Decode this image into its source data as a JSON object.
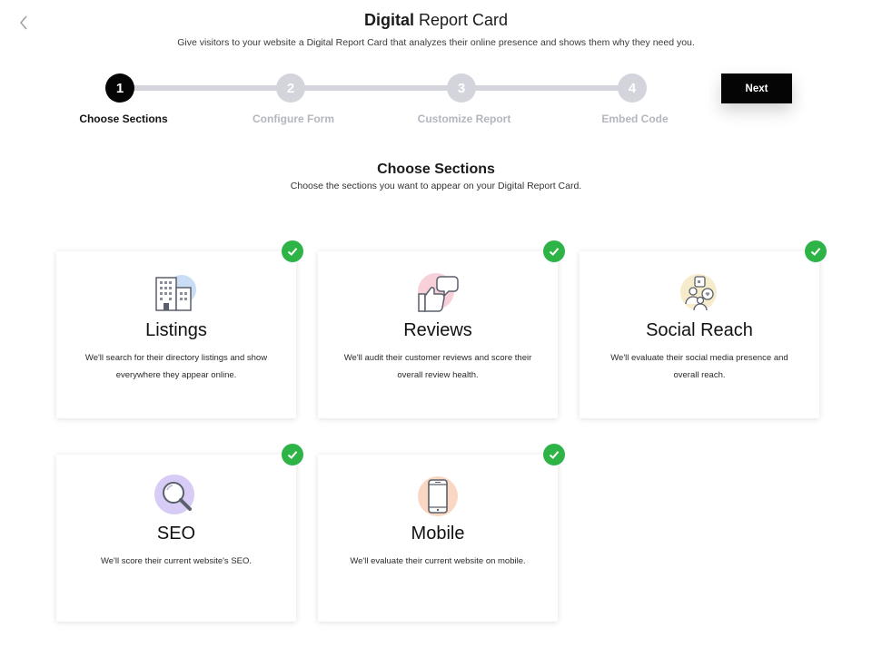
{
  "header": {
    "title_bold": "Digital",
    "title_rest": " Report Card",
    "subtitle": "Give visitors to your website a Digital Report Card that analyzes their online presence and shows them why they need you."
  },
  "stepper": {
    "steps": [
      {
        "number": "1",
        "label": "Choose Sections",
        "active": true
      },
      {
        "number": "2",
        "label": "Configure Form",
        "active": false
      },
      {
        "number": "3",
        "label": "Customize Report",
        "active": false
      },
      {
        "number": "4",
        "label": "Embed Code",
        "active": false
      }
    ],
    "next_label": "Next"
  },
  "section": {
    "title": "Choose Sections",
    "subtitle": "Choose the sections you want to appear on your Digital Report Card."
  },
  "cards": [
    {
      "title": "Listings",
      "description": "We'll search for their directory listings and show everywhere they appear online.",
      "icon": "building-icon",
      "selected": true
    },
    {
      "title": "Reviews",
      "description": "We'll audit their customer reviews and score their overall review health.",
      "icon": "thumbs-up-chat-icon",
      "selected": true
    },
    {
      "title": "Social Reach",
      "description": "We'll evaluate their social media presence and overall reach.",
      "icon": "social-people-icon",
      "selected": true
    },
    {
      "title": "SEO",
      "description": "We'll score their current website's SEO.",
      "icon": "magnifier-icon",
      "selected": true
    },
    {
      "title": "Mobile",
      "description": "We'll evaluate their current website on mobile.",
      "icon": "mobile-phone-icon",
      "selected": true
    }
  ],
  "colors": {
    "accent": "#050505",
    "check": "#2eb347",
    "step_inactive": "#d3d4dc"
  }
}
